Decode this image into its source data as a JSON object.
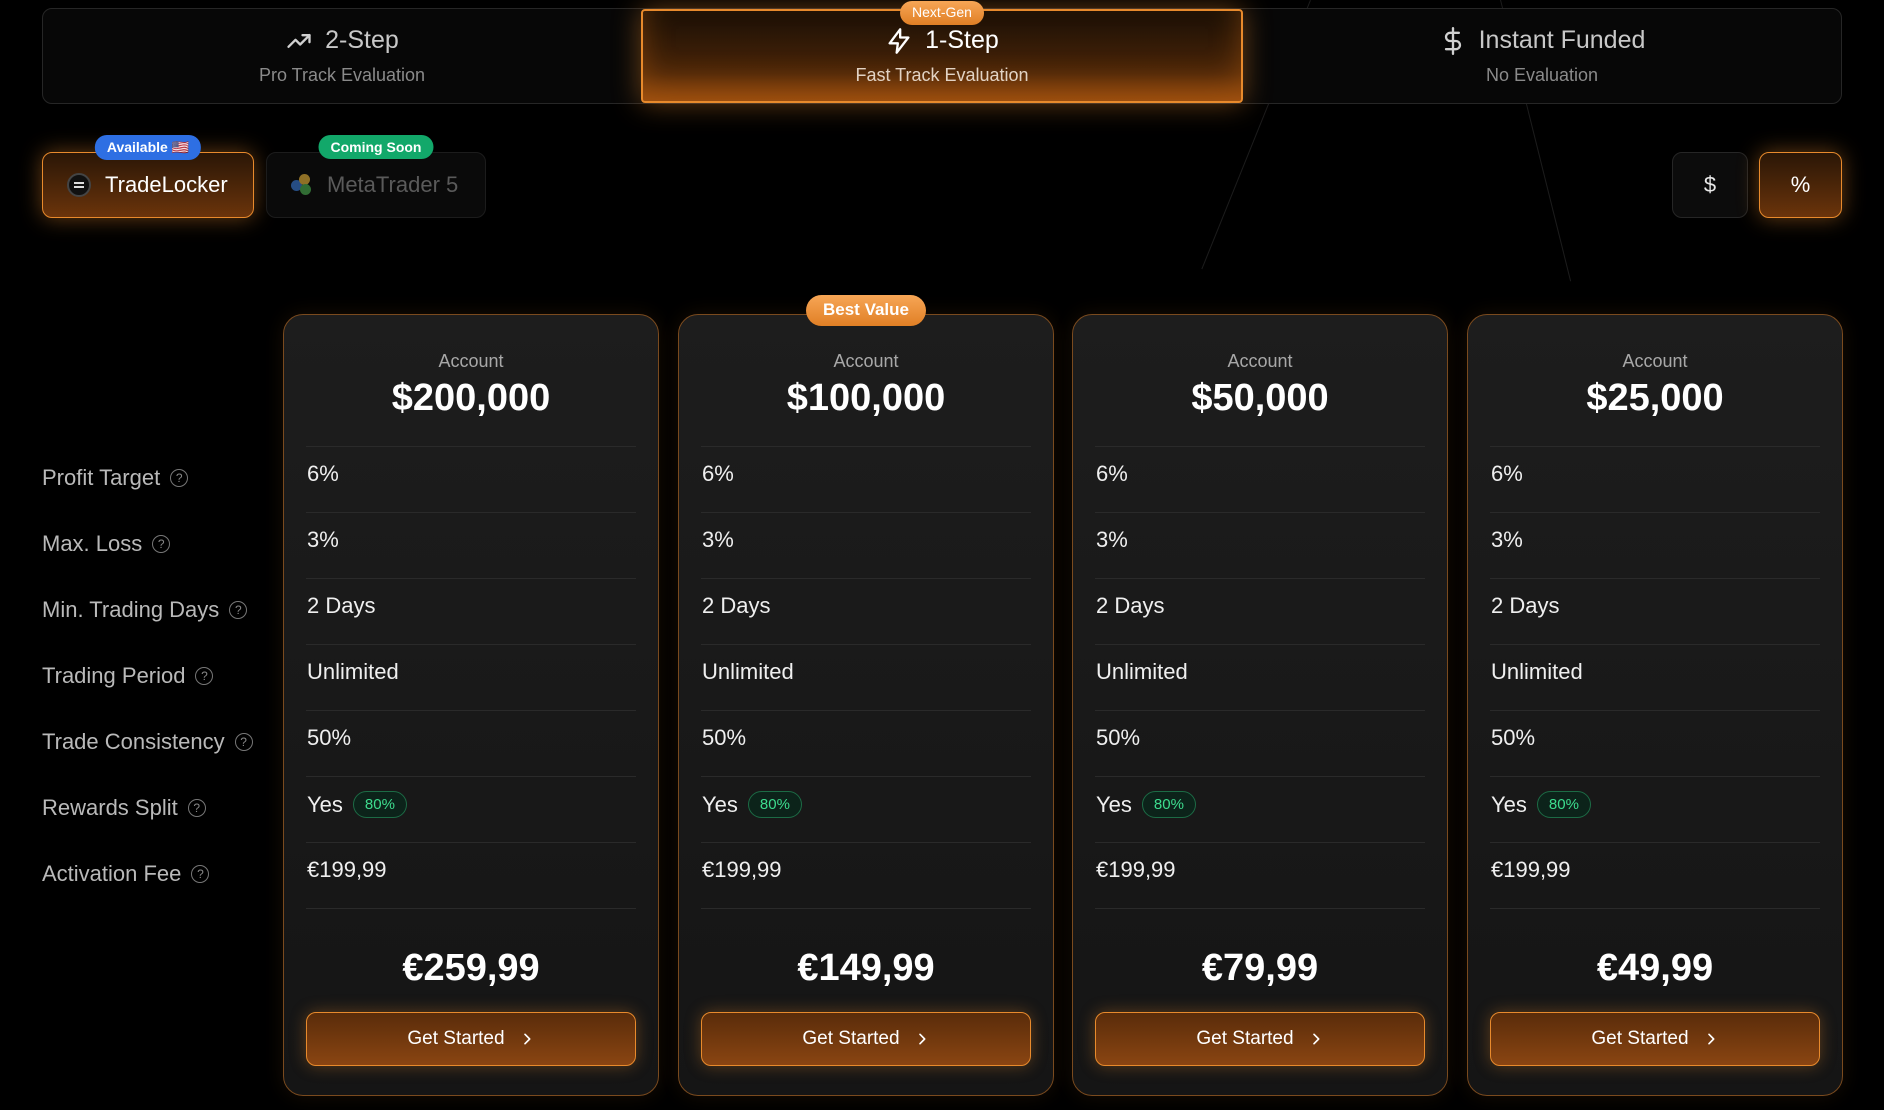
{
  "tabs": [
    {
      "title": "2-Step",
      "subtitle": "Pro Track Evaluation",
      "icon": "trending-up-icon",
      "active": false,
      "badge": ""
    },
    {
      "title": "1-Step",
      "subtitle": "Fast Track Evaluation",
      "icon": "lightning-icon",
      "active": true,
      "badge": "Next-Gen"
    },
    {
      "title": "Instant Funded",
      "subtitle": "No Evaluation",
      "icon": "dollar-icon",
      "active": false,
      "badge": ""
    }
  ],
  "platforms": [
    {
      "label": "TradeLocker",
      "badge": "Available 🇺🇸",
      "badge_color": "#2e6fe3",
      "selected": true
    },
    {
      "label": "MetaTrader 5",
      "badge": "Coming Soon",
      "badge_color": "#12a86a",
      "selected": false
    }
  ],
  "currency_toggle": {
    "dollar": "$",
    "percent": "%",
    "selected": "%"
  },
  "row_labels": [
    "Profit Target",
    "Max. Loss",
    "Min. Trading Days",
    "Trading Period",
    "Trade Consistency",
    "Rewards Split",
    "Activation Fee"
  ],
  "account_label": "Account",
  "cta_label": "Get Started",
  "accent_color": "#e88a2c",
  "cards": [
    {
      "size": "$200,000",
      "profit_target": "6%",
      "max_loss": "3%",
      "min_days": "2 Days",
      "period": "Unlimited",
      "consistency": "50%",
      "rewards": "Yes",
      "split": "80%",
      "activation_fee": "€199,99",
      "price": "€259,99",
      "badge": ""
    },
    {
      "size": "$100,000",
      "profit_target": "6%",
      "max_loss": "3%",
      "min_days": "2 Days",
      "period": "Unlimited",
      "consistency": "50%",
      "rewards": "Yes",
      "split": "80%",
      "activation_fee": "€199,99",
      "price": "€149,99",
      "badge": "Best Value"
    },
    {
      "size": "$50,000",
      "profit_target": "6%",
      "max_loss": "3%",
      "min_days": "2 Days",
      "period": "Unlimited",
      "consistency": "50%",
      "rewards": "Yes",
      "split": "80%",
      "activation_fee": "€199,99",
      "price": "€79,99",
      "badge": ""
    },
    {
      "size": "$25,000",
      "profit_target": "6%",
      "max_loss": "3%",
      "min_days": "2 Days",
      "period": "Unlimited",
      "consistency": "50%",
      "rewards": "Yes",
      "split": "80%",
      "activation_fee": "€199,99",
      "price": "€49,99",
      "badge": ""
    }
  ]
}
